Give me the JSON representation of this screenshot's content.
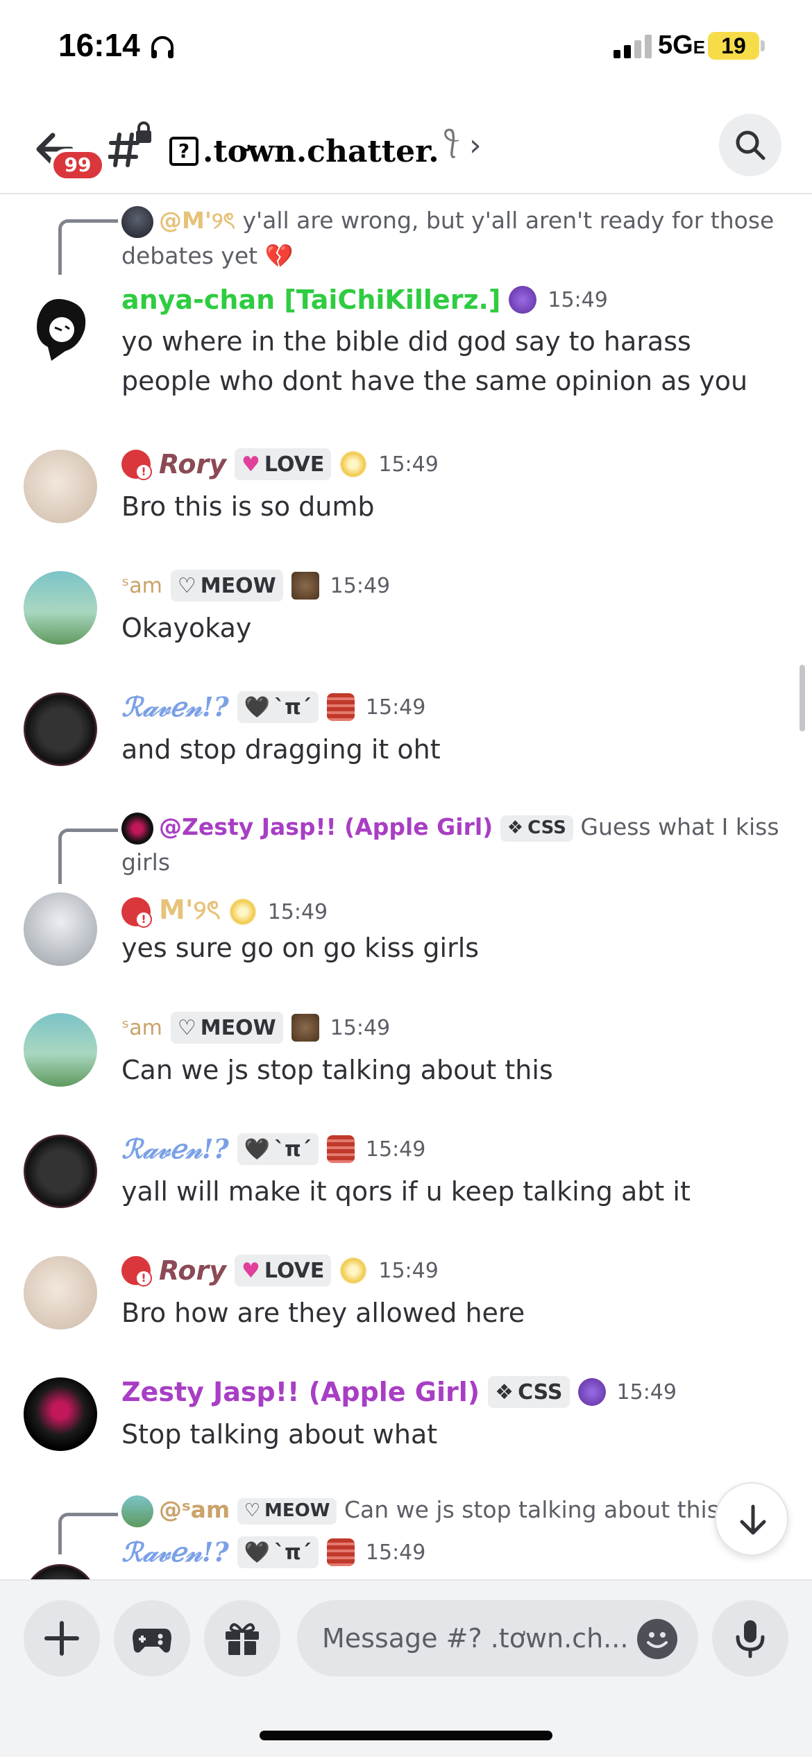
{
  "status_bar": {
    "time": "16:14",
    "network": "5G",
    "network_suffix": "E",
    "battery": "19"
  },
  "header": {
    "unread_badge": "99",
    "channel_prefix": "?",
    "channel_name": ".tơwn.chatter.",
    "channel_suffix": "ꪻ"
  },
  "messages": [
    {
      "reply": {
        "mention": "@M'୨ৎ",
        "text": "y'all are wrong, but y'all aren't ready for those debates yet 💔"
      },
      "author": "anya-chan [TaiChiKillerz.]",
      "author_color": "#2ecc40",
      "timestamp": "15:49",
      "text": "yo where in the bible did god say to harass people who dont have the same opinion as you"
    },
    {
      "author": "Rory",
      "author_color": "#8b4a55",
      "tag": "LOVE",
      "timestamp": "15:49",
      "text": "Bro this is so dumb"
    },
    {
      "author": "ˢam",
      "author_color": "#c9a36a",
      "tag": "MEOW",
      "timestamp": "15:49",
      "text": "Okayokay"
    },
    {
      "author": "ℛ𝒶𝓋ℯ𝓃!?",
      "author_color": "#7aa0e6",
      "tag": "ˋπˊ",
      "timestamp": "15:49",
      "text": "and stop dragging it oht"
    },
    {
      "reply": {
        "mention": "@Zesty Jasp!! (Apple Girl)",
        "tag": "CSS",
        "text": "Guess what I kiss girls"
      },
      "author": "M'୨ৎ",
      "author_color": "#e6c27a",
      "timestamp": "15:49",
      "text": "yes sure go on go kiss girls"
    },
    {
      "author": "ˢam",
      "author_color": "#c9a36a",
      "tag": "MEOW",
      "timestamp": "15:49",
      "text": "Can we js stop talking about this"
    },
    {
      "author": "ℛ𝒶𝓋ℯ𝓃!?",
      "author_color": "#7aa0e6",
      "tag": "ˋπˊ",
      "timestamp": "15:49",
      "text": "yall will make it qors if u keep talking abt it"
    },
    {
      "author": "Rory",
      "author_color": "#8b4a55",
      "tag": "LOVE",
      "timestamp": "15:49",
      "text": "Bro how are they allowed here"
    },
    {
      "author": "Zesty Jasp!! (Apple Girl)",
      "author_color": "#a83ec4",
      "tag": "CSS",
      "timestamp": "15:49",
      "text": "Stop talking about what"
    },
    {
      "reply": {
        "mention": "@ˢam",
        "tag": "MEOW",
        "text": "Can we js stop talking about this"
      },
      "author": "ℛ𝒶𝓋ℯ𝓃!?",
      "author_color": "#7aa0e6",
      "tag": "ˋπˊ",
      "timestamp": "15:49",
      "text": ""
    }
  ],
  "composer": {
    "placeholder": "Message #? .tơwn.ch..."
  },
  "icons": {
    "back": "arrow-left-icon",
    "channel": "locked-hash-icon",
    "search": "search-icon",
    "add": "plus-icon",
    "games": "gamepad-icon",
    "gift": "gift-icon",
    "emoji": "smiley-icon",
    "voice": "microphone-icon",
    "scroll": "arrow-down-icon"
  },
  "colors": {
    "accent_red": "#da373c",
    "background": "#ffffff",
    "text": "#2e3035",
    "muted": "#5c5e66"
  }
}
